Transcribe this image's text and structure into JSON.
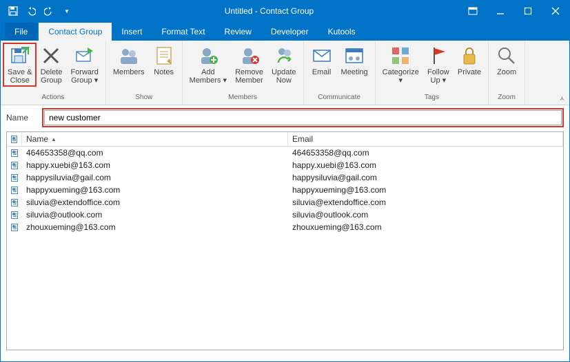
{
  "title": "Untitled  -  Contact Group",
  "qat": {
    "save": "💾",
    "undo": "↶",
    "redo": "↷"
  },
  "tabs": [
    "File",
    "Contact Group",
    "Insert",
    "Format Text",
    "Review",
    "Developer",
    "Kutools"
  ],
  "active_tab": 1,
  "ribbon_groups": [
    {
      "label": "Actions",
      "buttons": [
        {
          "id": "save-close",
          "line1": "Save &",
          "line2": "Close",
          "highlight": true
        },
        {
          "id": "delete-group",
          "line1": "Delete",
          "line2": "Group"
        },
        {
          "id": "forward-group",
          "line1": "Forward",
          "line2": "Group ▾"
        }
      ]
    },
    {
      "label": "Show",
      "buttons": [
        {
          "id": "members",
          "line1": "Members",
          "line2": ""
        },
        {
          "id": "notes",
          "line1": "Notes",
          "line2": ""
        }
      ]
    },
    {
      "label": "Members",
      "buttons": [
        {
          "id": "add-members",
          "line1": "Add",
          "line2": "Members ▾"
        },
        {
          "id": "remove-member",
          "line1": "Remove",
          "line2": "Member"
        },
        {
          "id": "update-now",
          "line1": "Update",
          "line2": "Now"
        }
      ]
    },
    {
      "label": "Communicate",
      "buttons": [
        {
          "id": "email",
          "line1": "Email",
          "line2": ""
        },
        {
          "id": "meeting",
          "line1": "Meeting",
          "line2": ""
        }
      ]
    },
    {
      "label": "Tags",
      "buttons": [
        {
          "id": "categorize",
          "line1": "Categorize",
          "line2": "▾"
        },
        {
          "id": "follow-up",
          "line1": "Follow",
          "line2": "Up ▾"
        },
        {
          "id": "private",
          "line1": "Private",
          "line2": ""
        }
      ]
    },
    {
      "label": "Zoom",
      "buttons": [
        {
          "id": "zoom",
          "line1": "Zoom",
          "line2": ""
        }
      ]
    }
  ],
  "name_label": "Name",
  "name_value": "new customer",
  "columns": {
    "icon": "",
    "name": "Name",
    "email": "Email"
  },
  "rows": [
    {
      "name": "464653358@qq.com",
      "email": "464653358@qq.com"
    },
    {
      "name": "happy.xuebi@163.com",
      "email": "happy.xuebi@163.com"
    },
    {
      "name": "happysiluvia@gail.com",
      "email": "happysiluvia@gail.com"
    },
    {
      "name": "happyxueming@163.com",
      "email": "happyxueming@163.com"
    },
    {
      "name": "siluvia@extendoffice.com",
      "email": "siluvia@extendoffice.com"
    },
    {
      "name": "siluvia@outlook.com",
      "email": "siluvia@outlook.com"
    },
    {
      "name": "zhouxueming@163.com",
      "email": "zhouxueming@163.com"
    }
  ]
}
